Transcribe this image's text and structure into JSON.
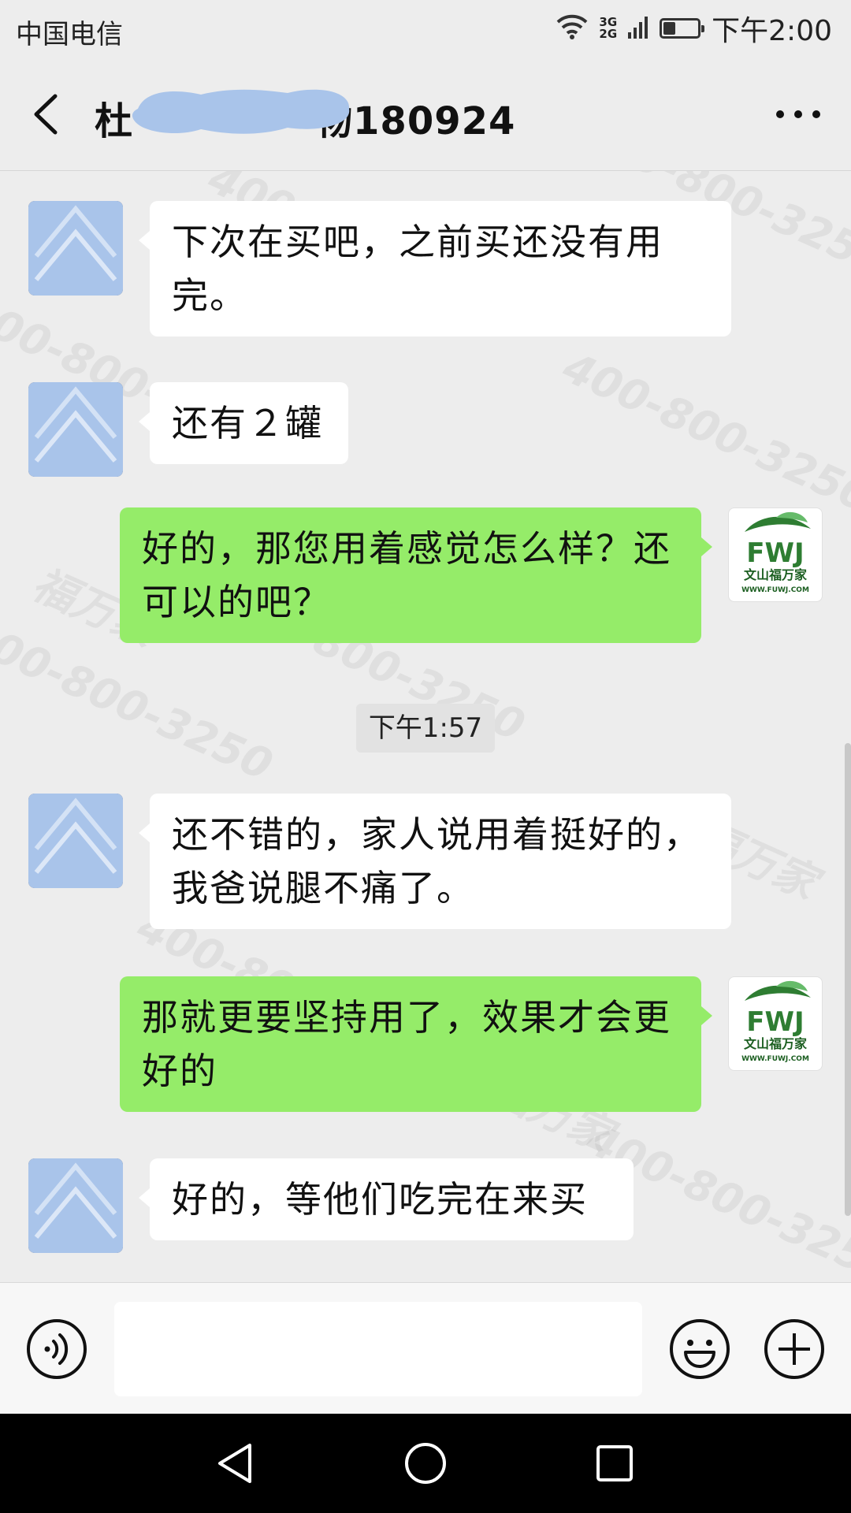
{
  "status_bar": {
    "carrier": "中国电信",
    "network_top": "3G",
    "network_bottom": "2G",
    "battery_level": 0.35,
    "time": "下午2:00"
  },
  "header": {
    "title": "杜",
    "title_suffix": "物180924",
    "back_icon": "chevron-left-icon",
    "more_icon": "more-horizontal-icon"
  },
  "messages": [
    {
      "side": "left",
      "text": "下次在买吧，之前买还没有用完。"
    },
    {
      "side": "left",
      "text": "还有２罐"
    },
    {
      "side": "right",
      "text": "好的，那您用着感觉怎么样？还可以的吧？"
    },
    {
      "side": "time",
      "text": "下午1:57"
    },
    {
      "side": "left",
      "text": "还不错的，家人说用着挺好的，我爸说腿不痛了。"
    },
    {
      "side": "right",
      "text": "那就更要坚持用了，效果才会更好的"
    },
    {
      "side": "left",
      "text": "好的，等他们吃完在来买"
    }
  ],
  "self_avatar": {
    "logo_text": "FWJ",
    "logo_cn": "文山福万家",
    "logo_url": "WWW.FUWJ.COM"
  },
  "watermark": {
    "phone": "400-800-3250",
    "brand": "福万家"
  },
  "input_bar": {
    "value": "",
    "voice_icon": "voice-icon",
    "emoji_icon": "emoji-icon",
    "plus_icon": "plus-circle-icon"
  },
  "nav_bar": {
    "back_icon": "triangle-back-icon",
    "home_icon": "circle-home-icon",
    "recents_icon": "square-recents-icon"
  },
  "colors": {
    "background": "#ededed",
    "bubble_self": "#95ec69",
    "bubble_peer": "#ffffff",
    "brand_green": "#2e7d32"
  }
}
